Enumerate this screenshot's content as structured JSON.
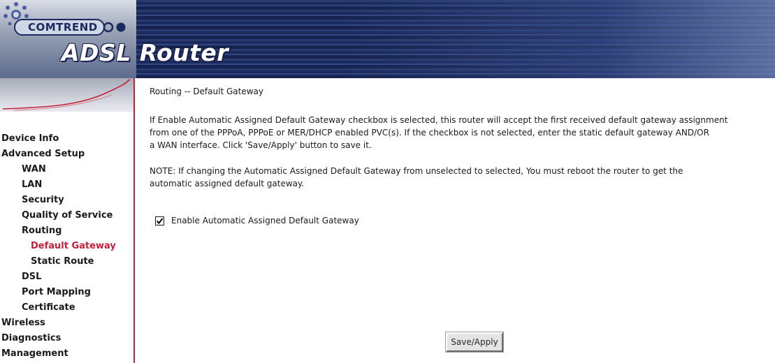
{
  "header": {
    "brand": "COMTREND",
    "product": "ADSL Router"
  },
  "sidebar": {
    "items": [
      {
        "label": "Device Info",
        "level": 1,
        "active": false
      },
      {
        "label": "Advanced Setup",
        "level": 1,
        "active": false
      },
      {
        "label": "WAN",
        "level": 2,
        "active": false
      },
      {
        "label": "LAN",
        "level": 2,
        "active": false
      },
      {
        "label": "Security",
        "level": 2,
        "active": false
      },
      {
        "label": "Quality of Service",
        "level": 2,
        "active": false
      },
      {
        "label": "Routing",
        "level": 2,
        "active": false
      },
      {
        "label": "Default Gateway",
        "level": 3,
        "active": true
      },
      {
        "label": "Static Route",
        "level": 3,
        "active": false
      },
      {
        "label": "DSL",
        "level": 2,
        "active": false
      },
      {
        "label": "Port Mapping",
        "level": 2,
        "active": false
      },
      {
        "label": "Certificate",
        "level": 2,
        "active": false
      },
      {
        "label": "Wireless",
        "level": 1,
        "active": false
      },
      {
        "label": "Diagnostics",
        "level": 1,
        "active": false
      },
      {
        "label": "Management",
        "level": 1,
        "active": false
      }
    ]
  },
  "main": {
    "title": "Routing -- Default Gateway",
    "description_lines": [
      "If Enable Automatic Assigned Default Gateway checkbox is selected, this router will accept the first received default gateway assignment",
      "from one of the PPPoA, PPPoE or MER/DHCP enabled PVC(s). If the checkbox is not selected, enter the static default gateway AND/OR",
      "a WAN interface. Click 'Save/Apply' button to save it."
    ],
    "note_lines": [
      "NOTE: If changing the Automatic Assigned Default Gateway from unselected to selected, You must reboot the router to get the",
      "automatic assigned default gateway."
    ],
    "auto_gateway": {
      "label": "Enable Automatic Assigned Default Gateway",
      "checked": true
    },
    "save_button_label": "Save/Apply"
  },
  "colors": {
    "accent_red": "#c41f3a",
    "banner_navy": "#1c2b5a"
  },
  "icons": {
    "logo": "comtrend-sun-icon",
    "checkbox": "checkmark-icon"
  }
}
